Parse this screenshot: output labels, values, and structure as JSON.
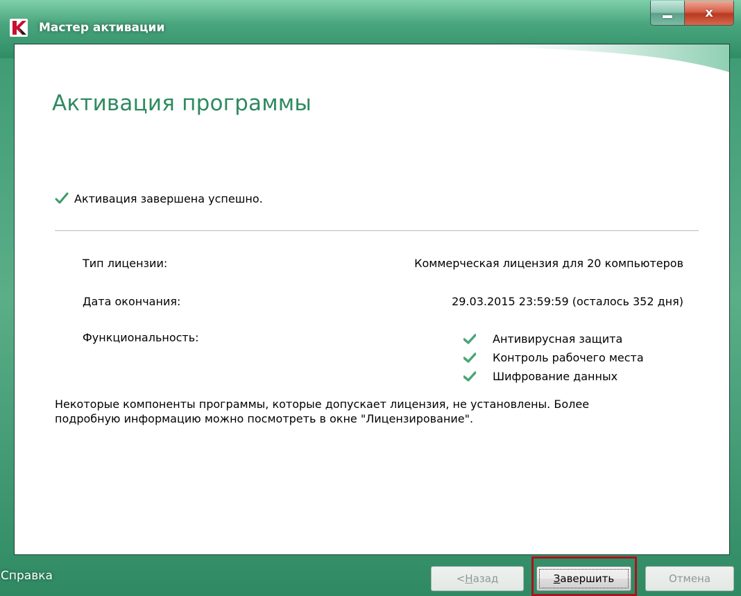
{
  "window": {
    "title": "Мастер активации",
    "minimize_icon": "minimize-icon",
    "close_glyph": "x"
  },
  "page": {
    "heading": "Активация программы",
    "status_icon": "checkmark-icon",
    "status_text": "Активация завершена успешно."
  },
  "license": {
    "type_label": "Тип лицензии:",
    "type_value": "Коммерческая лицензия для 20 компьютеров",
    "expiry_label": "Дата окончания:",
    "expiry_value": "29.03.2015 23:59:59 (осталось 352 дня)",
    "features_label": "Функциональность:",
    "features": [
      {
        "label": "Антивирусная защита",
        "icon": "checkmark-icon"
      },
      {
        "label": "Контроль рабочего места",
        "icon": "checkmark-icon"
      },
      {
        "label": "Шифрование данных",
        "icon": "checkmark-icon"
      }
    ]
  },
  "note": {
    "line1": "Некоторые компоненты программы, которые допускает лицензия, не установлены. Более",
    "line2": "подробную информацию можно посмотреть в окне \"Лицензирование\"."
  },
  "footer": {
    "help_label": "Справка",
    "back_prefix": "< ",
    "back_mnemonic": "Н",
    "back_rest": "азад",
    "finish_mnemonic": "З",
    "finish_rest": "авершить",
    "cancel_label": "Отмена"
  },
  "colors": {
    "accent_green": "#2f8a5f",
    "frame_green": "#3d9a73",
    "highlight_red": "#a8141b"
  }
}
